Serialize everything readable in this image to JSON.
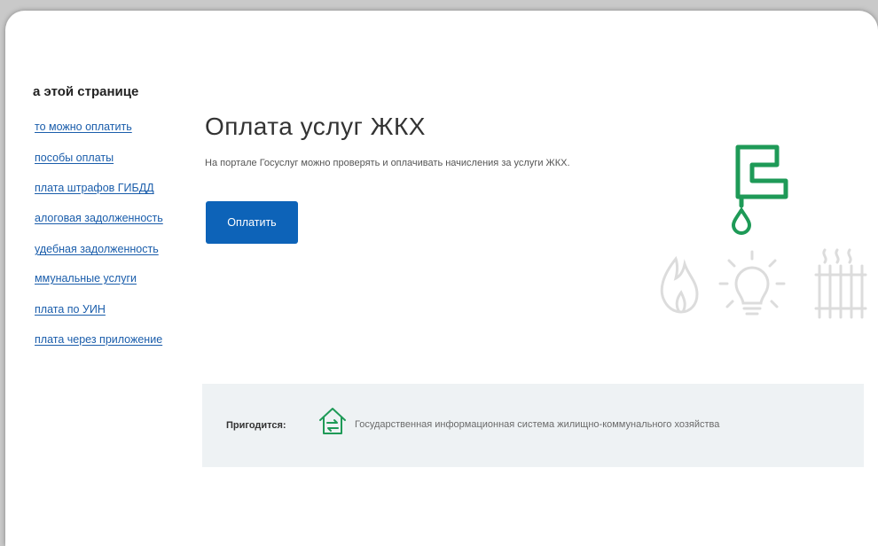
{
  "sidebar": {
    "title": "а этой странице",
    "items": [
      {
        "label": "то можно оплатить"
      },
      {
        "label": "пособы оплаты"
      },
      {
        "label": "плата штрафов ГИБДД"
      },
      {
        "label": "алоговая задолженность"
      },
      {
        "label": "удебная задолженность"
      },
      {
        "label": "ммунальные услуги"
      },
      {
        "label": "плата по УИН"
      },
      {
        "label": "плата через приложение"
      }
    ]
  },
  "main": {
    "title": "Оплата услуг ЖКХ",
    "intro": "На портале Госуслуг можно проверять и оплачивать начисления за услуги ЖКХ.",
    "pay_button_label": "Оплатить"
  },
  "useful": {
    "label": "Пригодится:",
    "link_text": "Государственная информационная система жилищно-коммунального хозяйства",
    "icon": "house-exchange-icon"
  },
  "illustration": {
    "icons": [
      "faucet-icon",
      "water-drop-icon",
      "flame-icon",
      "light-bulb-icon",
      "radiator-icon"
    ]
  },
  "colors": {
    "accent": "#0d63b8",
    "link": "#1a5dab",
    "faucet": "#1e9a57",
    "box_bg": "#eef2f4"
  }
}
